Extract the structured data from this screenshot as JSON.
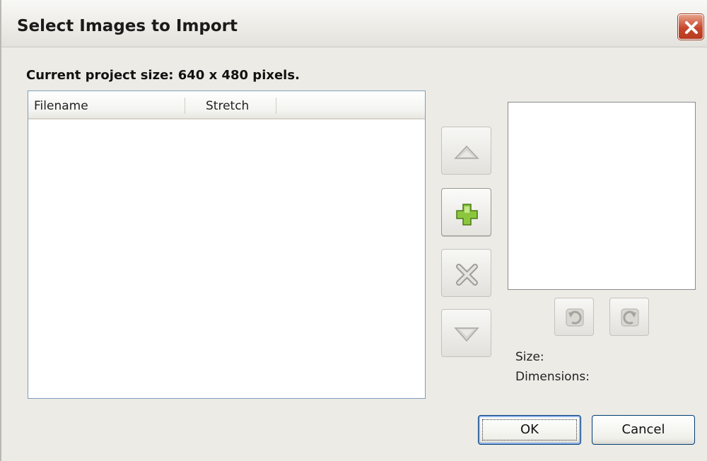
{
  "window": {
    "title": "Select Images to Import"
  },
  "info": {
    "project_size_text": "Current project size: 640 x 480 pixels."
  },
  "list": {
    "columns": [
      "Filename",
      "Stretch"
    ],
    "rows": []
  },
  "side_buttons": [
    "move-up",
    "add",
    "remove",
    "move-down"
  ],
  "preview": {
    "size_label": "Size:",
    "dimensions_label": "Dimensions:"
  },
  "footer": {
    "ok_label": "OK",
    "cancel_label": "Cancel"
  },
  "colors": {
    "add_icon_green": "#8cc63e",
    "close_red": "#c5482d"
  }
}
